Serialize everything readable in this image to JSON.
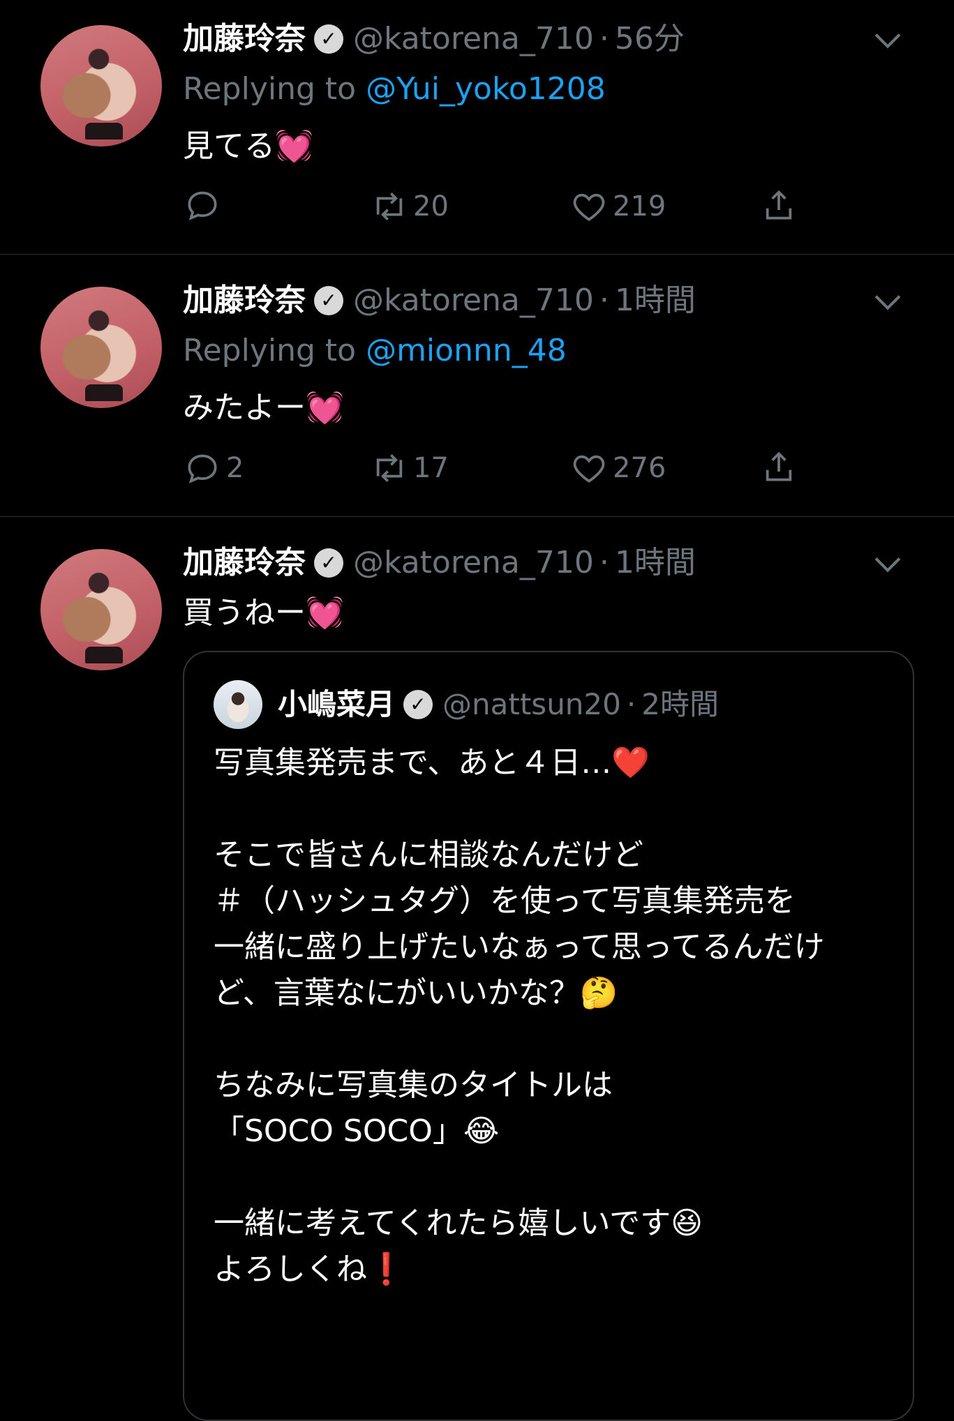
{
  "tweets": [
    {
      "name": "加藤玲奈",
      "handle": "@katorena_710",
      "time": "56分",
      "reply_prefix": "Replying to",
      "reply_to": "@Yui_yoko1208",
      "text": "見てる💓",
      "replies": "",
      "retweets": "20",
      "likes": "219"
    },
    {
      "name": "加藤玲奈",
      "handle": "@katorena_710",
      "time": "1時間",
      "reply_prefix": "Replying to",
      "reply_to": "@mionnn_48",
      "text": "みたよー💓",
      "replies": "2",
      "retweets": "17",
      "likes": "276"
    },
    {
      "name": "加藤玲奈",
      "handle": "@katorena_710",
      "time": "1時間",
      "text": "買うねー💓",
      "quote": {
        "name": "小嶋菜月",
        "handle": "@nattsun20",
        "time": "2時間",
        "lines": [
          "写真集発売まで、あと４日…❤️",
          "",
          "そこで皆さんに相談なんだけど",
          "＃（ハッシュタグ）を使って写真集発売を",
          "一緒に盛り上げたいなぁって思ってるんだけ",
          "ど、言葉なにがいいかな？🤔",
          "",
          "ちなみに写真集のタイトルは",
          "「SOCO SOCO」😂",
          "",
          "一緒に考えてくれたら嬉しいです😆",
          "よろしくね❗️"
        ]
      }
    }
  ],
  "icons": {
    "verified": "verified-badge-icon",
    "caret": "chevron-down-icon",
    "reply": "reply-icon",
    "retweet": "retweet-icon",
    "like": "heart-icon",
    "share": "share-icon"
  },
  "colors": {
    "background": "#000000",
    "secondary_text": "#6e767d",
    "mention": "#1da1f2",
    "divider": "#2f3336"
  }
}
